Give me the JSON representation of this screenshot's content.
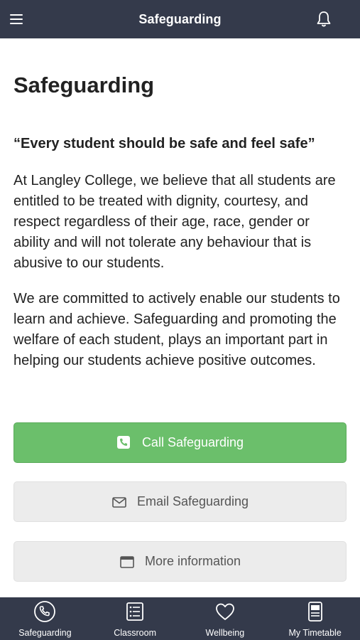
{
  "header": {
    "title": "Safeguarding",
    "menu_icon": "hamburger-menu-icon",
    "bell_icon": "bell-icon"
  },
  "main": {
    "heading": "Safeguarding",
    "quote": "“Every student should be safe and feel safe”",
    "paragraphs": [
      "At Langley College, we believe that all students are entitled to be treated with dignity, courtesy, and respect regardless of their age, race, gender or ability and will not tolerate any behaviour that is abusive to our students.",
      "We are committed to actively enable our students to learn and achieve. Safeguarding and promoting the welfare of each student, plays an important part in helping our students achieve positive outcomes."
    ],
    "buttons": {
      "call": {
        "label": "Call Safeguarding",
        "icon": "phone-icon"
      },
      "email": {
        "label": "Email Safeguarding",
        "icon": "envelope-icon"
      },
      "more": {
        "label": "More information",
        "icon": "browser-window-icon"
      }
    }
  },
  "tabbar": {
    "tabs": [
      {
        "label": "Safeguarding",
        "icon": "phone-circle-icon"
      },
      {
        "label": "Classroom",
        "icon": "list-icon"
      },
      {
        "label": "Wellbeing",
        "icon": "heart-icon"
      },
      {
        "label": "My Timetable",
        "icon": "timetable-icon"
      }
    ]
  },
  "colors": {
    "header_bg": "#343a4b",
    "call_button": "#6bbf6b",
    "secondary_button": "#ececec"
  }
}
